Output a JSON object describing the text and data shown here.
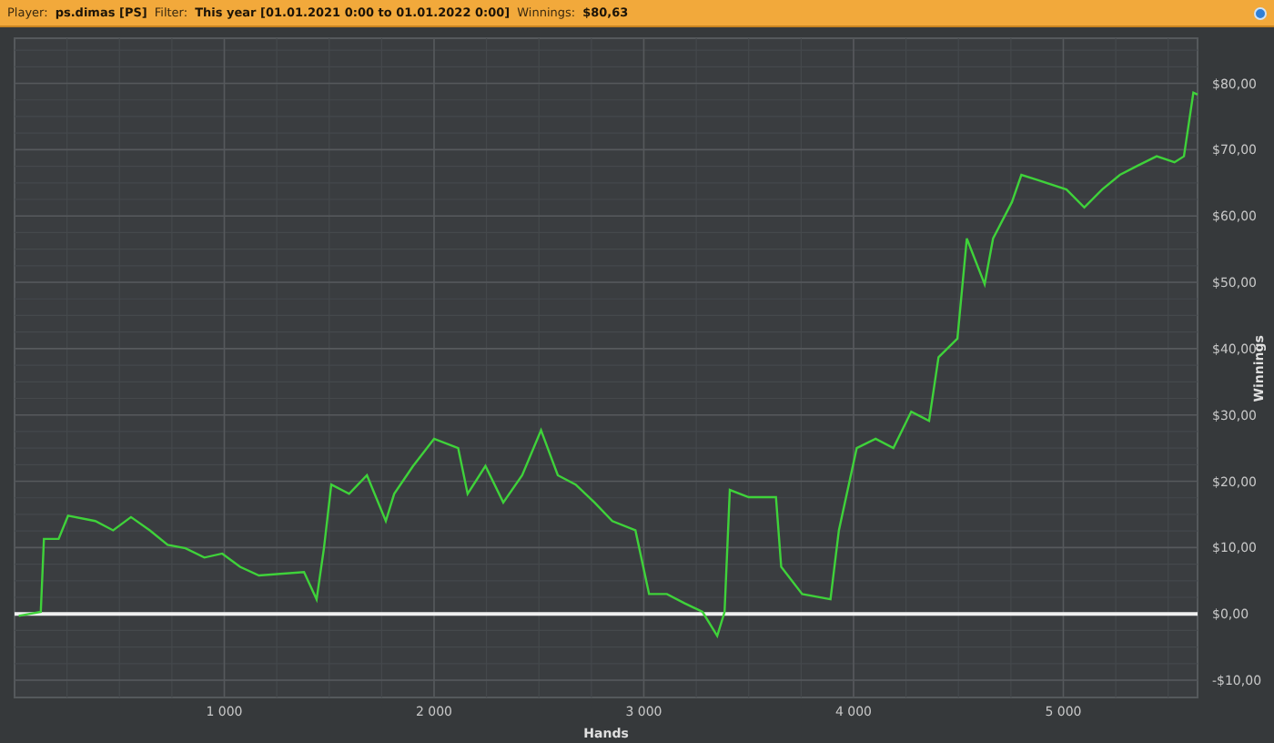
{
  "header": {
    "fields": [
      {
        "label": "Player:",
        "value": "ps.dimas [PS]"
      },
      {
        "label": "Filter:",
        "value": "This year [01.01.2021 0:00 to 01.01.2022 0:00]"
      },
      {
        "label": "Winnings:",
        "value": "$80,63"
      }
    ]
  },
  "chart": {
    "chart_data": {
      "type": "line",
      "grid": true,
      "xlabel": "Hands",
      "ylabel": "Winnings",
      "xlim": [
        0,
        5640
      ],
      "ylim": [
        -12.6,
        86.8
      ],
      "xticks": [
        {
          "value": 1000,
          "label": "1 000"
        },
        {
          "value": 2000,
          "label": "2 000"
        },
        {
          "value": 3000,
          "label": "3 000"
        },
        {
          "value": 4000,
          "label": "4 000"
        },
        {
          "value": 5000,
          "label": "5 000"
        }
      ],
      "yticks": [
        {
          "value": -10,
          "label": "-$10,00"
        },
        {
          "value": 0,
          "label": "$0,00"
        },
        {
          "value": 10,
          "label": "$10,00"
        },
        {
          "value": 20,
          "label": "$20,00"
        },
        {
          "value": 30,
          "label": "$30,00"
        },
        {
          "value": 40,
          "label": "$40,00"
        },
        {
          "value": 50,
          "label": "$50,00"
        },
        {
          "value": 60,
          "label": "$60,00"
        },
        {
          "value": 70,
          "label": "$70,00"
        },
        {
          "value": 80,
          "label": "$80,00"
        }
      ],
      "x": [
        20,
        125,
        140,
        210,
        255,
        385,
        470,
        555,
        645,
        730,
        815,
        905,
        990,
        1075,
        1165,
        1380,
        1440,
        1475,
        1510,
        1595,
        1680,
        1770,
        1810,
        1900,
        2000,
        2115,
        2160,
        2245,
        2330,
        2420,
        2510,
        2590,
        2675,
        2765,
        2850,
        2960,
        3025,
        3110,
        3195,
        3280,
        3350,
        3385,
        3410,
        3500,
        3630,
        3655,
        3755,
        3890,
        3930,
        4015,
        4105,
        4190,
        4275,
        4360,
        4405,
        4495,
        4540,
        4625,
        4665,
        4755,
        4800,
        4880,
        5015,
        5100,
        5185,
        5270,
        5355,
        5445,
        5530,
        5575,
        5620,
        5640
      ],
      "series": [
        {
          "color": "#3fd23a",
          "values": [
            -0.3,
            0.3,
            11.3,
            11.3,
            14.8,
            14,
            12.6,
            14.6,
            12.6,
            10.4,
            9.9,
            8.5,
            9.1,
            7.1,
            5.8,
            6.3,
            2.2,
            9.9,
            19.5,
            18.1,
            20.9,
            14,
            18.1,
            22.3,
            26.4,
            25,
            18.1,
            22.3,
            16.8,
            20.9,
            27.7,
            20.9,
            19.5,
            16.8,
            14,
            12.6,
            3,
            3,
            1.6,
            0.3,
            -3.3,
            0.3,
            18.7,
            17.6,
            17.6,
            7.1,
            3,
            2.2,
            12.6,
            25,
            26.4,
            25,
            30.5,
            29.1,
            38.7,
            41.5,
            56.6,
            49.7,
            56.6,
            62.1,
            66.2,
            65.4,
            64,
            61.3,
            64,
            66.2,
            67.6,
            69,
            68.1,
            69,
            78.6,
            78.3
          ]
        }
      ]
    }
  }
}
